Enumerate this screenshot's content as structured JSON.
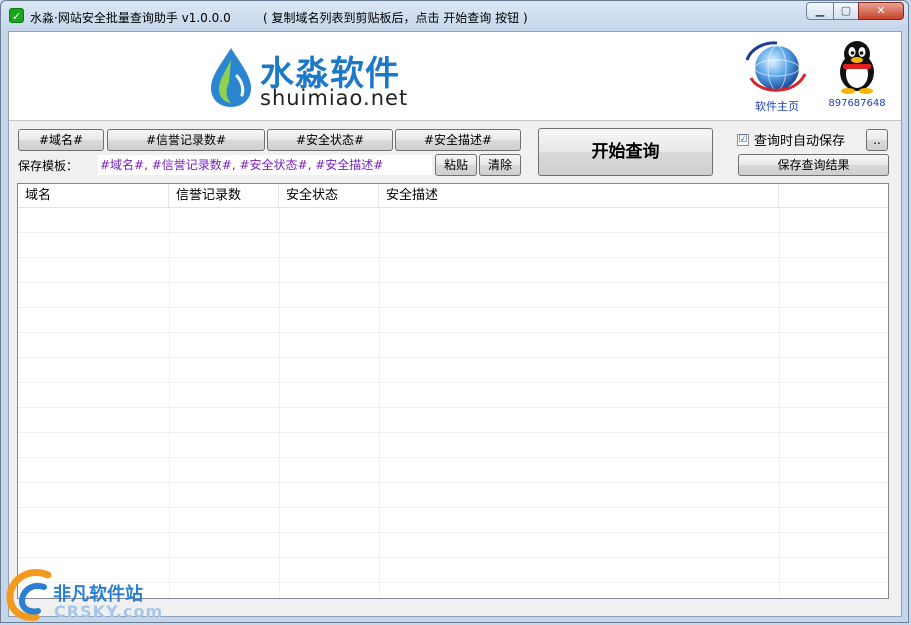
{
  "window": {
    "title": "水淼·网站安全批量查询助手 v1.0.0.0",
    "hint": "( 复制域名列表到剪贴板后，点击 开始查询 按钮 )",
    "icon": "shield-check-icon",
    "accent_color": "#19a51c"
  },
  "banner": {
    "brand_cn": "水淼软件",
    "brand_en": "shuimiao.net",
    "home_label": "软件主页",
    "qq_label": "897687648"
  },
  "toolbar": {
    "tags": [
      "#域名#",
      "#信誉记录数#",
      "#安全状态#",
      "#安全描述#"
    ],
    "template_label": "保存模板：",
    "template_value": "#域名#, #信誉记录数#, #安全状态#, #安全描述#",
    "paste_label": "粘贴",
    "clear_label": "清除",
    "start_label": "开始查询",
    "auto_save_label": "查询时自动保存",
    "auto_save_checked": "☑",
    "browse_label": "..",
    "save_results_label": "保存查询结果"
  },
  "table": {
    "columns": [
      "域名",
      "信誉记录数",
      "安全状态",
      "安全描述",
      ""
    ]
  },
  "watermark": {
    "cn": "非凡软件站",
    "en": "CRSKY.com"
  }
}
